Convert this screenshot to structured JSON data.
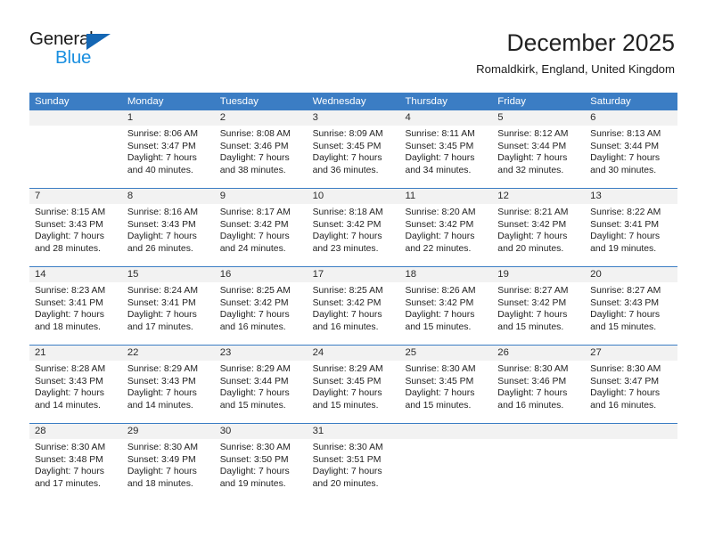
{
  "brand": {
    "name_part1": "General",
    "name_part2": "Blue",
    "accent_color": "#1a8fe0",
    "triangle_color": "#1567b4"
  },
  "header": {
    "month_title": "December 2025",
    "location": "Romaldkirk, England, United Kingdom"
  },
  "calendar": {
    "header_bg": "#3b7dc4",
    "weekdays": [
      "Sunday",
      "Monday",
      "Tuesday",
      "Wednesday",
      "Thursday",
      "Friday",
      "Saturday"
    ],
    "weeks": [
      [
        {
          "day": "",
          "sunrise": "",
          "sunset": "",
          "daylight_line1": "",
          "daylight_line2": "",
          "empty": true
        },
        {
          "day": "1",
          "sunrise": "Sunrise: 8:06 AM",
          "sunset": "Sunset: 3:47 PM",
          "daylight_line1": "Daylight: 7 hours",
          "daylight_line2": "and 40 minutes."
        },
        {
          "day": "2",
          "sunrise": "Sunrise: 8:08 AM",
          "sunset": "Sunset: 3:46 PM",
          "daylight_line1": "Daylight: 7 hours",
          "daylight_line2": "and 38 minutes."
        },
        {
          "day": "3",
          "sunrise": "Sunrise: 8:09 AM",
          "sunset": "Sunset: 3:45 PM",
          "daylight_line1": "Daylight: 7 hours",
          "daylight_line2": "and 36 minutes."
        },
        {
          "day": "4",
          "sunrise": "Sunrise: 8:11 AM",
          "sunset": "Sunset: 3:45 PM",
          "daylight_line1": "Daylight: 7 hours",
          "daylight_line2": "and 34 minutes."
        },
        {
          "day": "5",
          "sunrise": "Sunrise: 8:12 AM",
          "sunset": "Sunset: 3:44 PM",
          "daylight_line1": "Daylight: 7 hours",
          "daylight_line2": "and 32 minutes."
        },
        {
          "day": "6",
          "sunrise": "Sunrise: 8:13 AM",
          "sunset": "Sunset: 3:44 PM",
          "daylight_line1": "Daylight: 7 hours",
          "daylight_line2": "and 30 minutes."
        }
      ],
      [
        {
          "day": "7",
          "sunrise": "Sunrise: 8:15 AM",
          "sunset": "Sunset: 3:43 PM",
          "daylight_line1": "Daylight: 7 hours",
          "daylight_line2": "and 28 minutes."
        },
        {
          "day": "8",
          "sunrise": "Sunrise: 8:16 AM",
          "sunset": "Sunset: 3:43 PM",
          "daylight_line1": "Daylight: 7 hours",
          "daylight_line2": "and 26 minutes."
        },
        {
          "day": "9",
          "sunrise": "Sunrise: 8:17 AM",
          "sunset": "Sunset: 3:42 PM",
          "daylight_line1": "Daylight: 7 hours",
          "daylight_line2": "and 24 minutes."
        },
        {
          "day": "10",
          "sunrise": "Sunrise: 8:18 AM",
          "sunset": "Sunset: 3:42 PM",
          "daylight_line1": "Daylight: 7 hours",
          "daylight_line2": "and 23 minutes."
        },
        {
          "day": "11",
          "sunrise": "Sunrise: 8:20 AM",
          "sunset": "Sunset: 3:42 PM",
          "daylight_line1": "Daylight: 7 hours",
          "daylight_line2": "and 22 minutes."
        },
        {
          "day": "12",
          "sunrise": "Sunrise: 8:21 AM",
          "sunset": "Sunset: 3:42 PM",
          "daylight_line1": "Daylight: 7 hours",
          "daylight_line2": "and 20 minutes."
        },
        {
          "day": "13",
          "sunrise": "Sunrise: 8:22 AM",
          "sunset": "Sunset: 3:41 PM",
          "daylight_line1": "Daylight: 7 hours",
          "daylight_line2": "and 19 minutes."
        }
      ],
      [
        {
          "day": "14",
          "sunrise": "Sunrise: 8:23 AM",
          "sunset": "Sunset: 3:41 PM",
          "daylight_line1": "Daylight: 7 hours",
          "daylight_line2": "and 18 minutes."
        },
        {
          "day": "15",
          "sunrise": "Sunrise: 8:24 AM",
          "sunset": "Sunset: 3:41 PM",
          "daylight_line1": "Daylight: 7 hours",
          "daylight_line2": "and 17 minutes."
        },
        {
          "day": "16",
          "sunrise": "Sunrise: 8:25 AM",
          "sunset": "Sunset: 3:42 PM",
          "daylight_line1": "Daylight: 7 hours",
          "daylight_line2": "and 16 minutes."
        },
        {
          "day": "17",
          "sunrise": "Sunrise: 8:25 AM",
          "sunset": "Sunset: 3:42 PM",
          "daylight_line1": "Daylight: 7 hours",
          "daylight_line2": "and 16 minutes."
        },
        {
          "day": "18",
          "sunrise": "Sunrise: 8:26 AM",
          "sunset": "Sunset: 3:42 PM",
          "daylight_line1": "Daylight: 7 hours",
          "daylight_line2": "and 15 minutes."
        },
        {
          "day": "19",
          "sunrise": "Sunrise: 8:27 AM",
          "sunset": "Sunset: 3:42 PM",
          "daylight_line1": "Daylight: 7 hours",
          "daylight_line2": "and 15 minutes."
        },
        {
          "day": "20",
          "sunrise": "Sunrise: 8:27 AM",
          "sunset": "Sunset: 3:43 PM",
          "daylight_line1": "Daylight: 7 hours",
          "daylight_line2": "and 15 minutes."
        }
      ],
      [
        {
          "day": "21",
          "sunrise": "Sunrise: 8:28 AM",
          "sunset": "Sunset: 3:43 PM",
          "daylight_line1": "Daylight: 7 hours",
          "daylight_line2": "and 14 minutes."
        },
        {
          "day": "22",
          "sunrise": "Sunrise: 8:29 AM",
          "sunset": "Sunset: 3:43 PM",
          "daylight_line1": "Daylight: 7 hours",
          "daylight_line2": "and 14 minutes."
        },
        {
          "day": "23",
          "sunrise": "Sunrise: 8:29 AM",
          "sunset": "Sunset: 3:44 PM",
          "daylight_line1": "Daylight: 7 hours",
          "daylight_line2": "and 15 minutes."
        },
        {
          "day": "24",
          "sunrise": "Sunrise: 8:29 AM",
          "sunset": "Sunset: 3:45 PM",
          "daylight_line1": "Daylight: 7 hours",
          "daylight_line2": "and 15 minutes."
        },
        {
          "day": "25",
          "sunrise": "Sunrise: 8:30 AM",
          "sunset": "Sunset: 3:45 PM",
          "daylight_line1": "Daylight: 7 hours",
          "daylight_line2": "and 15 minutes."
        },
        {
          "day": "26",
          "sunrise": "Sunrise: 8:30 AM",
          "sunset": "Sunset: 3:46 PM",
          "daylight_line1": "Daylight: 7 hours",
          "daylight_line2": "and 16 minutes."
        },
        {
          "day": "27",
          "sunrise": "Sunrise: 8:30 AM",
          "sunset": "Sunset: 3:47 PM",
          "daylight_line1": "Daylight: 7 hours",
          "daylight_line2": "and 16 minutes."
        }
      ],
      [
        {
          "day": "28",
          "sunrise": "Sunrise: 8:30 AM",
          "sunset": "Sunset: 3:48 PM",
          "daylight_line1": "Daylight: 7 hours",
          "daylight_line2": "and 17 minutes."
        },
        {
          "day": "29",
          "sunrise": "Sunrise: 8:30 AM",
          "sunset": "Sunset: 3:49 PM",
          "daylight_line1": "Daylight: 7 hours",
          "daylight_line2": "and 18 minutes."
        },
        {
          "day": "30",
          "sunrise": "Sunrise: 8:30 AM",
          "sunset": "Sunset: 3:50 PM",
          "daylight_line1": "Daylight: 7 hours",
          "daylight_line2": "and 19 minutes."
        },
        {
          "day": "31",
          "sunrise": "Sunrise: 8:30 AM",
          "sunset": "Sunset: 3:51 PM",
          "daylight_line1": "Daylight: 7 hours",
          "daylight_line2": "and 20 minutes."
        },
        {
          "day": "",
          "sunrise": "",
          "sunset": "",
          "daylight_line1": "",
          "daylight_line2": "",
          "empty": true
        },
        {
          "day": "",
          "sunrise": "",
          "sunset": "",
          "daylight_line1": "",
          "daylight_line2": "",
          "empty": true
        },
        {
          "day": "",
          "sunrise": "",
          "sunset": "",
          "daylight_line1": "",
          "daylight_line2": "",
          "empty": true
        }
      ]
    ]
  }
}
